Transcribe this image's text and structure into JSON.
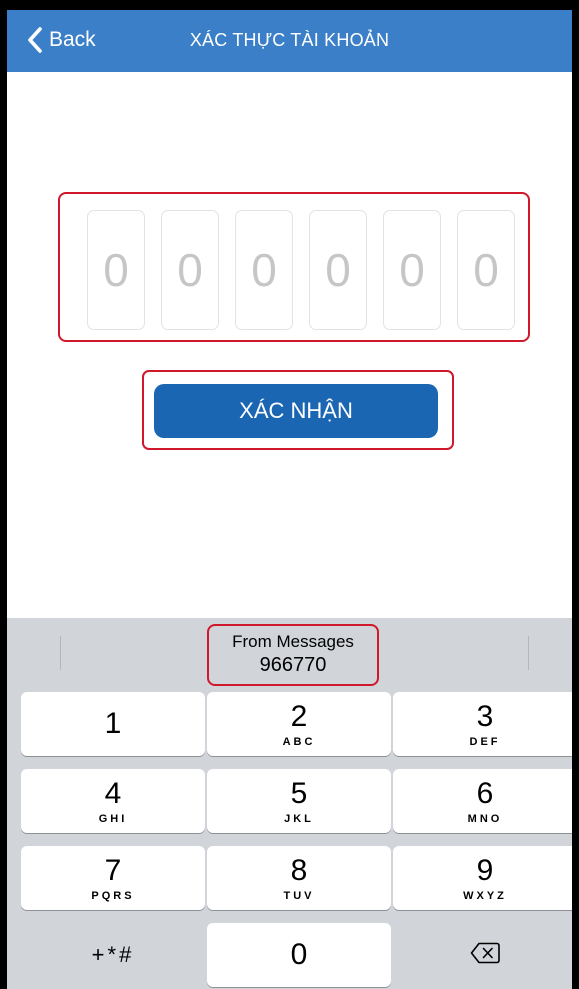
{
  "header": {
    "back_label": "Back",
    "title": "XÁC THỰC TÀI KHOẢN",
    "background": "#3a7fc7"
  },
  "otp": {
    "digits": [
      "0",
      "0",
      "0",
      "0",
      "0",
      "0"
    ],
    "highlight_color": "#d0182c"
  },
  "confirm_button": {
    "label": "XÁC NHẬN",
    "color": "#1b66b2"
  },
  "keyboard": {
    "suggestion": {
      "source_label": "From Messages",
      "code": "966770"
    },
    "keys": [
      {
        "digit": "1",
        "letters": ""
      },
      {
        "digit": "2",
        "letters": "ABC"
      },
      {
        "digit": "3",
        "letters": "DEF"
      },
      {
        "digit": "4",
        "letters": "GHI"
      },
      {
        "digit": "5",
        "letters": "JKL"
      },
      {
        "digit": "6",
        "letters": "MNO"
      },
      {
        "digit": "7",
        "letters": "PQRS"
      },
      {
        "digit": "8",
        "letters": "TUV"
      },
      {
        "digit": "9",
        "letters": "WXYZ"
      },
      {
        "digit": "0",
        "letters": ""
      }
    ],
    "symbols_label": "+*#",
    "delete_icon": "backspace-icon"
  }
}
